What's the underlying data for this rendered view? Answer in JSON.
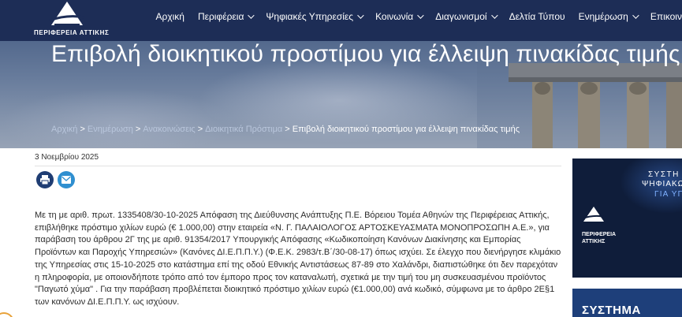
{
  "header": {
    "logo_text": "ΠΕΡΙΦΕΡΕΙΑ ΑΤΤΙΚΗΣ",
    "nav": [
      {
        "label": "Αρχική",
        "dropdown": false
      },
      {
        "label": "Περιφέρεια",
        "dropdown": true
      },
      {
        "label": "Ψηφιακές Υπηρεσίες",
        "dropdown": true
      },
      {
        "label": "Κοινωνία",
        "dropdown": true
      },
      {
        "label": "Διαγωνισμοί",
        "dropdown": true
      },
      {
        "label": "Δελτία Τύπου",
        "dropdown": false
      },
      {
        "label": "Ενημέρωση",
        "dropdown": true
      },
      {
        "label": "Επικοινωνία",
        "dropdown": true
      }
    ]
  },
  "hero": {
    "title": "Επιβολή διοικητικού προστίμου για έλλειψη πινακίδας τιμής",
    "breadcrumb": [
      "Αρχική",
      "Ενημέρωση",
      "Ανακοινώσεις",
      "Διοικητικά Πρόστιμα"
    ],
    "breadcrumb_current": "Επιβολή διοικητικού προστίμου για έλλειψη πινακίδας τιμής",
    "breadcrumb_separator": ">"
  },
  "article": {
    "date": "3 Νοεμβρίου 2025",
    "share_icons": [
      "print-icon",
      "email-icon"
    ],
    "body": "Με τη με αριθ. πρωτ. 1335408/30-10-2025 Απόφαση της Διεύθυνσης Ανάπτυξης Π.Ε. Βόρειου Τομέα Αθηνών της Περιφέρειας Αττικής, επιβλήθηκε πρόστιμο χιλίων ευρώ (€ 1.000,00) στην εταιρεία «Ν. Γ. ΠΑΛΑΙΟΛΟΓΟΣ ΑΡΤΟΣΚΕΥΑΣΜΑΤΑ ΜΟΝΟΠΡΟΣΩΠΗ Α.Ε.», για παράβαση του άρθρου 2Γ της με αριθ. 91354/2017 Υπουργικής Απόφασης «Κωδικοποίηση Κανόνων Διακίνησης και Εμπορίας Προϊόντων και Παροχής Υπηρεσιών» (Κανόνες ΔΙ.Ε.Π.Π.Υ.) (Φ.Ε.Κ. 2983/τ.Β΄/30-08-17) όπως ισχύει. Σε έλεγχο που διενήργησε κλιμάκιο της Υπηρεσίας στις 15-10-2025 στο κατάστημα επί της οδού Εθνικής Αντιστάσεως 87-89 στο Χαλάνδρι, διαπιστώθηκε ότι δεν παρεχόταν η πληροφορία, με οποιονδήποτε τρόπο από τον έμπορο προς τον καταναλωτή, σχετικά με την τιμή του μη συσκευασμένου προϊόντος \"Παγωτό χύμα\" . Για την παράβαση προβλέπεται διοικητικό πρόστιμο χιλίων ευρώ (€1.000,00)  ανά κωδικό, σύμφωνα με το άρθρο 2Ε§1 των κανόνων ΔΙ.Ε.Π.Π.Υ. ως ισχύουν."
  },
  "sidebar": {
    "banner1": {
      "line1": "ΣΥΣΤΗ",
      "line2": "ΨΗΦΙΑΚΩΝ Ε",
      "line3": "ΓΙΑ ΥΠΗΡΕΣΙΕ",
      "logo_line1": "ΠΕΡΙΦΕΡΕΙΑ",
      "logo_line2": "ΑΤΤΙΚΗΣ"
    },
    "banner2": {
      "text": "ΣΥΣΤΗΜΑ"
    }
  },
  "colors": {
    "header_bg": "#1d2d56",
    "print_icon": "#1f3d73",
    "email_icon": "#2f8fd0"
  }
}
